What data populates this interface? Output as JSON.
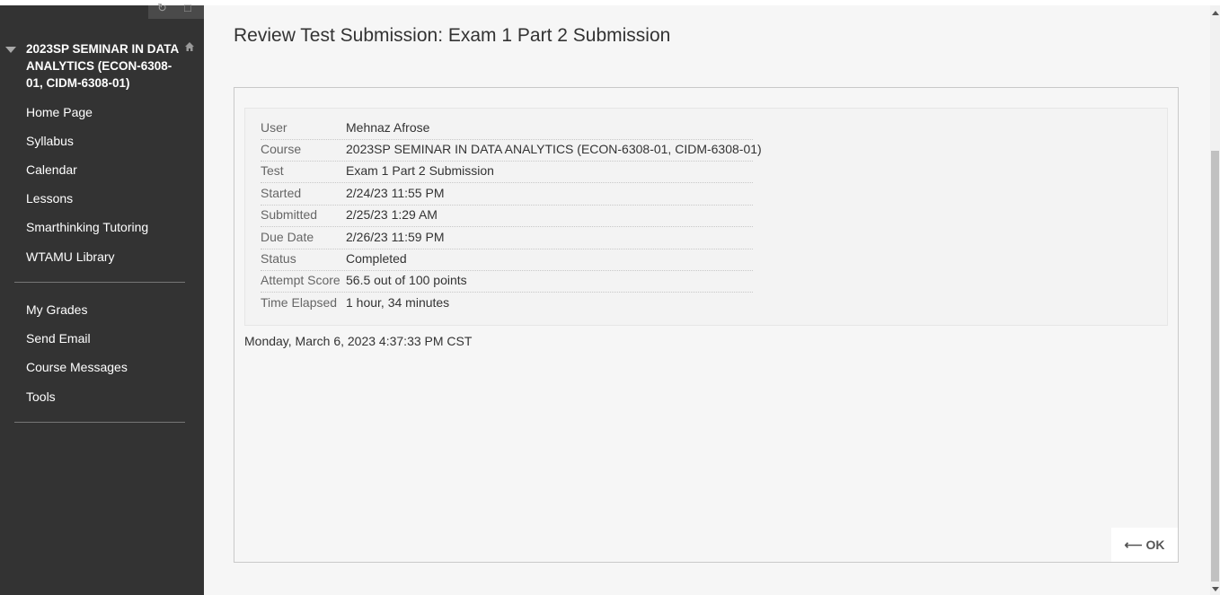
{
  "sidebar": {
    "course_title": "2023SP SEMINAR IN DATA ANALYTICS (ECON-6308-01, CIDM-6308-01)",
    "items_top": [
      "Home Page",
      "Syllabus",
      "Calendar",
      "Lessons",
      "Smarthinking Tutoring",
      "WTAMU Library"
    ],
    "items_bottom": [
      "My Grades",
      "Send Email",
      "Course Messages",
      "Tools"
    ]
  },
  "main": {
    "page_title": "Review Test Submission: Exam 1 Part 2 Submission",
    "details": [
      {
        "label": "User",
        "value": "Mehnaz Afrose"
      },
      {
        "label": "Course",
        "value": "2023SP SEMINAR IN DATA ANALYTICS (ECON-6308-01, CIDM-6308-01)"
      },
      {
        "label": "Test",
        "value": "Exam 1 Part 2 Submission"
      },
      {
        "label": "Started",
        "value": "2/24/23 11:55 PM"
      },
      {
        "label": "Submitted",
        "value": "2/25/23 1:29 AM"
      },
      {
        "label": "Due Date",
        "value": "2/26/23 11:59 PM"
      },
      {
        "label": "Status",
        "value": "Completed"
      },
      {
        "label": "Attempt Score",
        "value": "56.5 out of 100 points"
      },
      {
        "label": "Time Elapsed",
        "value": "1 hour, 34 minutes"
      }
    ],
    "timestamp": "Monday, March 6, 2023 4:37:33 PM CST",
    "ok_label": "⟵ OK"
  }
}
